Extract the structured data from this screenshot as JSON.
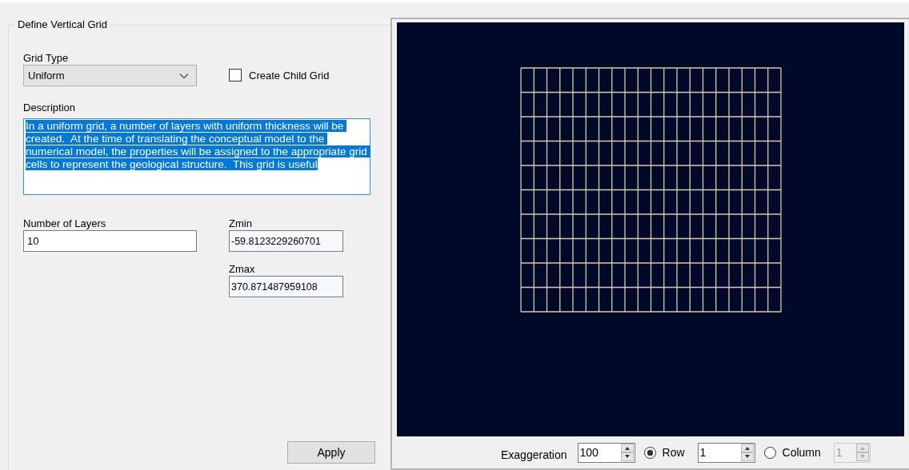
{
  "group": {
    "title": "Define Vertical Grid"
  },
  "grid_type": {
    "label": "Grid Type",
    "value": "Uniform"
  },
  "create_child_grid": {
    "label": "Create Child Grid",
    "checked": false
  },
  "description": {
    "label": "Description",
    "text": "In a uniform grid, a number of layers with uniform thickness will be created.  At the time of translating the conceptual model to the numerical model, the properties will be assigned to the appropriate grid cells to represent the geological structure.  This grid is useful",
    "highlighted": true
  },
  "number_of_layers": {
    "label": "Number of Layers",
    "value": "10"
  },
  "zmin": {
    "label": "Zmin",
    "value": "-59.8123229260701"
  },
  "zmax": {
    "label": "Zmax",
    "value": "370.871487959108"
  },
  "apply_button": "Apply",
  "view_controls": {
    "exaggeration": {
      "label": "Exaggeration",
      "value": "100"
    },
    "slices": [
      {
        "label": "Row",
        "selected": true,
        "value": "1",
        "disabled": false
      },
      {
        "label": "Column",
        "selected": false,
        "value": "1",
        "disabled": true
      }
    ]
  }
}
